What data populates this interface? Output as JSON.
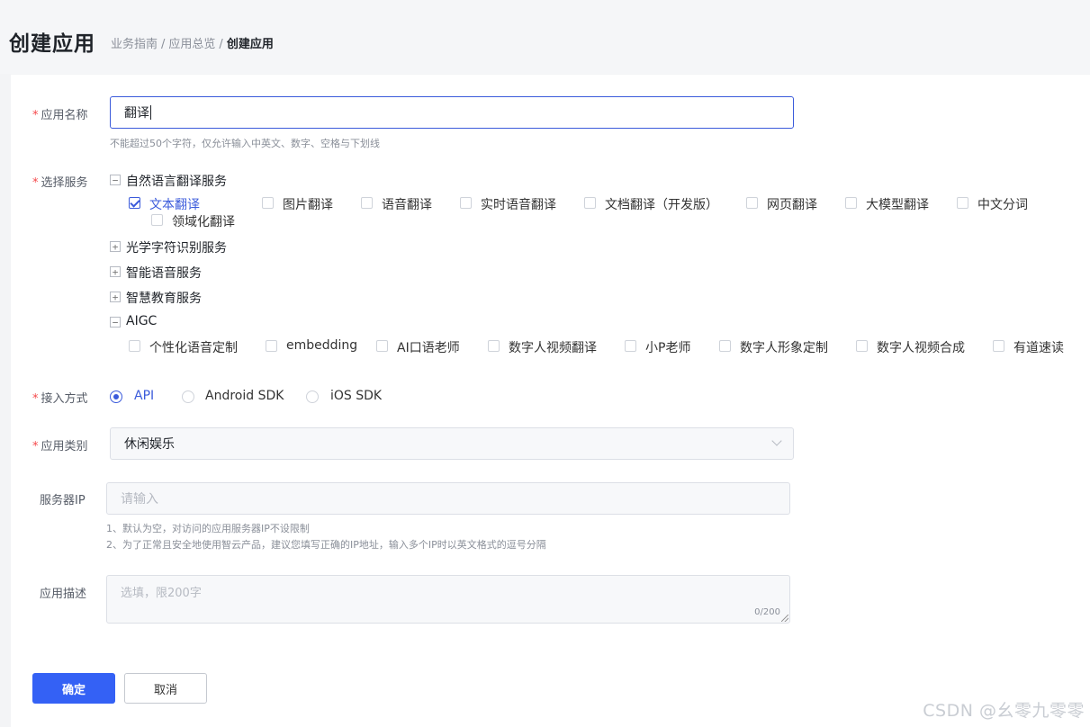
{
  "header": {
    "title": "创建应用",
    "breadcrumb": [
      "业务指南",
      "应用总览",
      "创建应用"
    ],
    "breadcrumb_sep": "/"
  },
  "form": {
    "name": {
      "label": "应用名称",
      "required_mark": "*",
      "value": "翻译",
      "hint": "不能超过50个字符，仅允许输入中英文、数字、空格与下划线"
    },
    "services": {
      "label": "选择服务",
      "required_mark": "*",
      "groups": [
        {
          "name": "自然语言翻译服务",
          "toggle": "−",
          "items": [
            {
              "label": "文本翻译",
              "checked": true
            },
            {
              "label": "图片翻译",
              "checked": false
            },
            {
              "label": "语音翻译",
              "checked": false
            },
            {
              "label": "实时语音翻译",
              "checked": false
            },
            {
              "label": "文档翻译（开发版）",
              "checked": false
            },
            {
              "label": "网页翻译",
              "checked": false
            },
            {
              "label": "大模型翻译",
              "checked": false
            },
            {
              "label": "中文分词",
              "checked": false
            },
            {
              "label": "领域化翻译",
              "checked": false
            }
          ]
        },
        {
          "name": "光学字符识别服务",
          "toggle": "+"
        },
        {
          "name": "智能语音服务",
          "toggle": "+"
        },
        {
          "name": "智慧教育服务",
          "toggle": "+"
        },
        {
          "name": "AIGC",
          "toggle": "−",
          "items": [
            {
              "label": "个性化语音定制",
              "checked": false
            },
            {
              "label": "embedding",
              "checked": false
            },
            {
              "label": "AI口语老师",
              "checked": false
            },
            {
              "label": "数字人视频翻译",
              "checked": false
            },
            {
              "label": "小P老师",
              "checked": false
            },
            {
              "label": "数字人形象定制",
              "checked": false
            },
            {
              "label": "数字人视频合成",
              "checked": false
            },
            {
              "label": "有道速读",
              "checked": false
            }
          ]
        }
      ]
    },
    "access": {
      "label": "接入方式",
      "required_mark": "*",
      "options": [
        "API",
        "Android SDK",
        "iOS SDK"
      ],
      "selected": "API"
    },
    "category": {
      "label": "应用类别",
      "required_mark": "*",
      "value": "休闲娱乐"
    },
    "server_ip": {
      "label": "服务器IP",
      "placeholder": "请输入",
      "hints": [
        "1、默认为空，对访问的应用服务器IP不设限制",
        "2、为了正常且安全地使用智云产品，建议您填写正确的IP地址，输入多个IP时以英文格式的逗号分隔"
      ]
    },
    "description": {
      "label": "应用描述",
      "placeholder": "选填，限200字",
      "counter": "0/200"
    }
  },
  "actions": {
    "confirm": "确定",
    "cancel": "取消"
  },
  "watermark": "CSDN @幺零九零零",
  "colors": {
    "primary": "#3461f5",
    "accent": "#3b5bdb",
    "required": "#f5484a"
  }
}
